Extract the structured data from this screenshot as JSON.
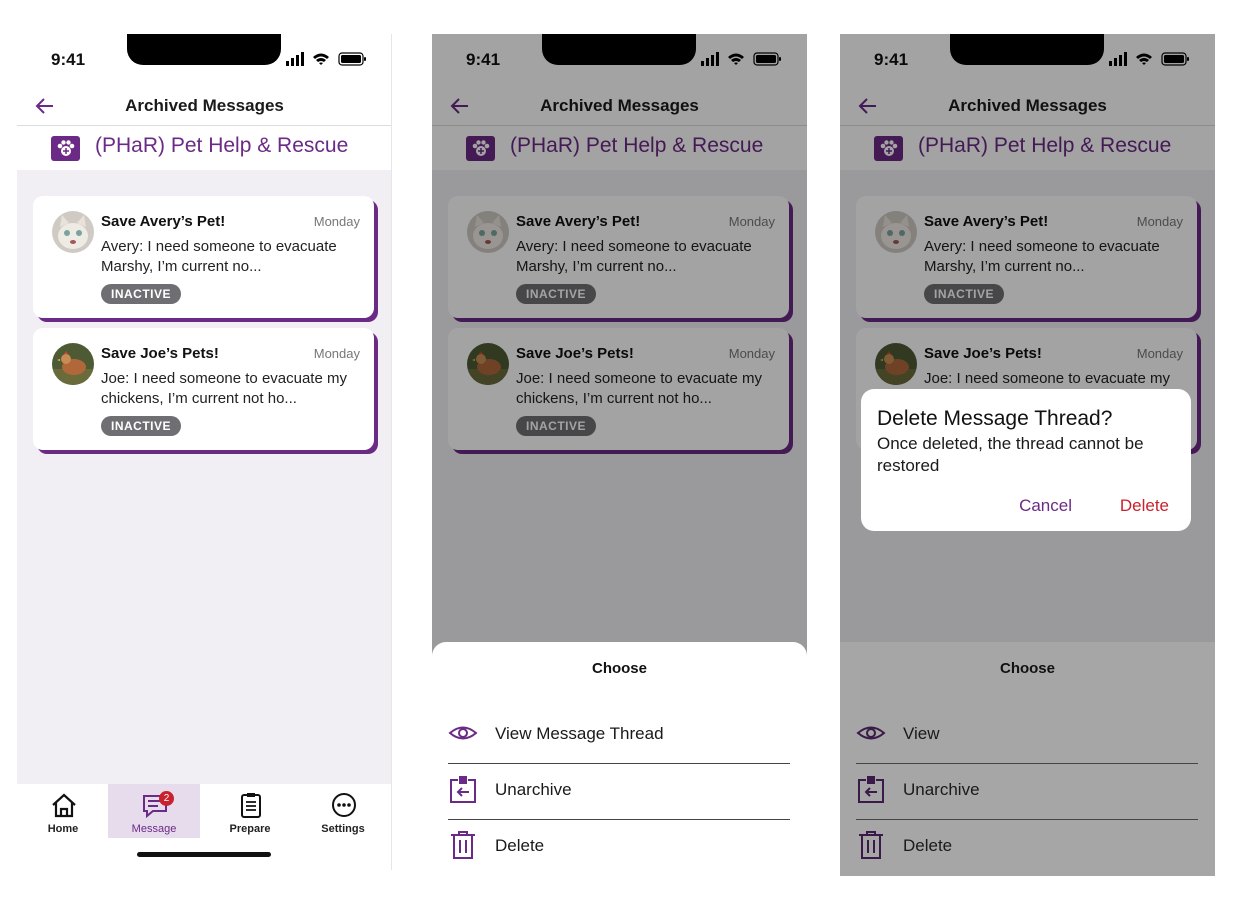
{
  "status_time": "9:41",
  "header_title": "Archived Messages",
  "org_name": "(PHaR) Pet Help & Rescue",
  "threads": [
    {
      "title": "Save Avery’s Pet!",
      "day": "Monday",
      "preview": "Avery: I need someone to evacuate Marshy, I’m current no...",
      "badge": "INACTIVE",
      "avatar_icon": "cat-avatar"
    },
    {
      "title": "Save Joe’s Pets!",
      "day": "Monday",
      "preview": "Joe: I need someone to evacuate my chickens, I’m current not ho...",
      "badge": "INACTIVE",
      "avatar_icon": "chicken-avatar"
    }
  ],
  "tabs": [
    {
      "label": "Home",
      "icon": "home-icon"
    },
    {
      "label": "Message",
      "icon": "message-icon",
      "badge": "2",
      "active": true
    },
    {
      "label": "Prepare",
      "icon": "clipboard-icon"
    },
    {
      "label": "Settings",
      "icon": "more-icon"
    }
  ],
  "sheet_a": {
    "title": "Choose",
    "options": [
      "View Message Thread",
      "Unarchive",
      "Delete"
    ]
  },
  "sheet_b": {
    "title": "Choose",
    "options": [
      "View",
      "Unarchive",
      "Delete"
    ]
  },
  "dialog": {
    "title": "Delete Message Thread?",
    "message": "Once deleted, the thread cannot be restored",
    "cancel": "Cancel",
    "confirm": "Delete"
  },
  "colors": {
    "brand": "#6b2a85",
    "danger": "#c8222c",
    "badge": "#6f6f73"
  }
}
